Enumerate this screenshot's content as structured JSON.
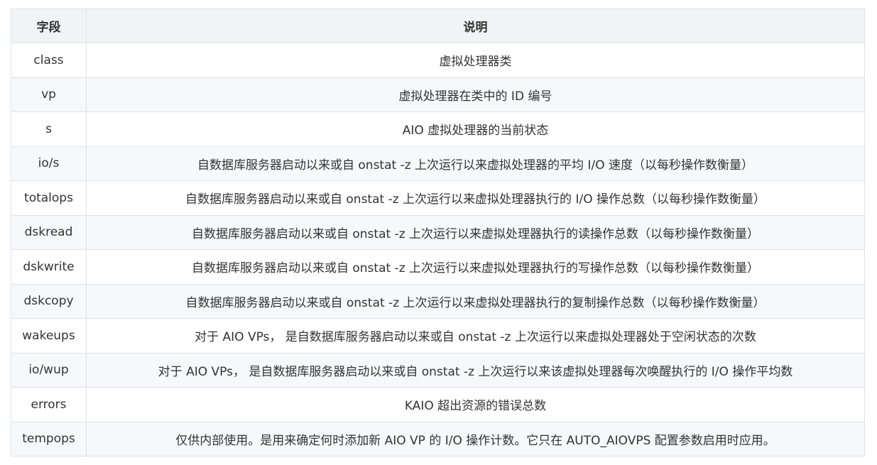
{
  "table": {
    "headers": [
      "字段",
      "说明"
    ],
    "rows": [
      {
        "field": "class",
        "desc": "虚拟处理器类"
      },
      {
        "field": "vp",
        "desc": "虚拟处理器在类中的 ID 编号"
      },
      {
        "field": "s",
        "desc": "AIO 虚拟处理器的当前状态"
      },
      {
        "field": "io/s",
        "desc": "自数据库服务器启动以来或自 onstat -z 上次运行以来虚拟处理器的平均 I/O 速度（以每秒操作数衡量）"
      },
      {
        "field": "totalops",
        "desc": "自数据库服务器启动以来或自 onstat -z 上次运行以来虚拟处理器执行的 I/O 操作总数（以每秒操作数衡量）"
      },
      {
        "field": "dskread",
        "desc": "自数据库服务器启动以来或自 onstat -z 上次运行以来虚拟处理器执行的读操作总数（以每秒操作数衡量）"
      },
      {
        "field": "dskwrite",
        "desc": "自数据库服务器启动以来或自 onstat -z 上次运行以来虚拟处理器执行的写操作总数（以每秒操作数衡量）"
      },
      {
        "field": "dskcopy",
        "desc": "自数据库服务器启动以来或自 onstat -z 上次运行以来虚拟处理器执行的复制操作总数（以每秒操作数衡量）"
      },
      {
        "field": "wakeups",
        "desc": "对于 AIO VPs， 是自数据库服务器启动以来或自 onstat -z 上次运行以来虚拟处理器处于空闲状态的次数"
      },
      {
        "field": "io/wup",
        "desc": "对于 AIO VPs， 是自数据库服务器启动以来或自 onstat -z 上次运行以来该虚拟处理器每次唤醒执行的 I/O 操作平均数"
      },
      {
        "field": "errors",
        "desc": "KAIO 超出资源的错误总数"
      },
      {
        "field": "tempops",
        "desc": "仅供内部使用。是用来确定何时添加新 AIO VP 的 I/O 操作计数。它只在 AUTO_AIOVPS 配置参数启用时应用。"
      }
    ]
  }
}
